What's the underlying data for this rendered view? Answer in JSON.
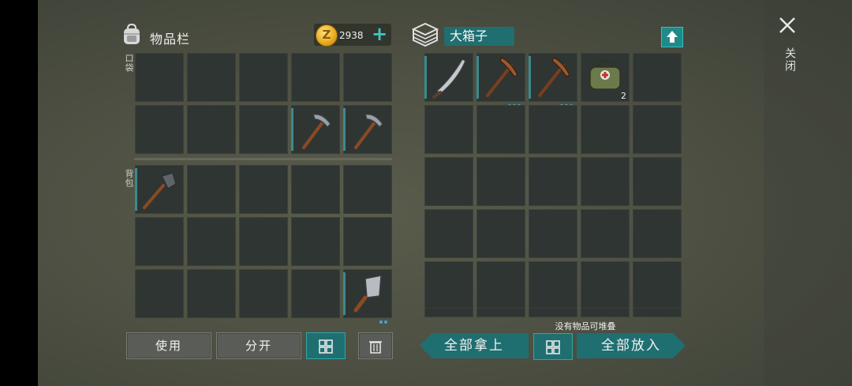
{
  "inventory": {
    "title": "物品栏",
    "coins": "2938",
    "pocket_label": "口袋",
    "backpack_label": "背包",
    "buttons": {
      "use": "使用",
      "split": "分开"
    }
  },
  "chest": {
    "name": "大箱子",
    "status": "没有物品可堆叠",
    "take_all": "全部拿上",
    "put_all": "全部放入",
    "medkit_qty": "2"
  },
  "close": {
    "label": "关闭"
  },
  "colors": {
    "accent": "#1f6f71",
    "accent_border": "#2fa6a8",
    "slot": "#2f3532"
  },
  "icons": [
    "backpack-icon",
    "coin-icon",
    "plus-icon",
    "chest-icon",
    "upload-icon",
    "pickaxe-icon",
    "shovel-icon",
    "cleaver-icon",
    "sword-icon",
    "medkit-icon",
    "grid-icon",
    "trash-icon",
    "close-icon"
  ]
}
